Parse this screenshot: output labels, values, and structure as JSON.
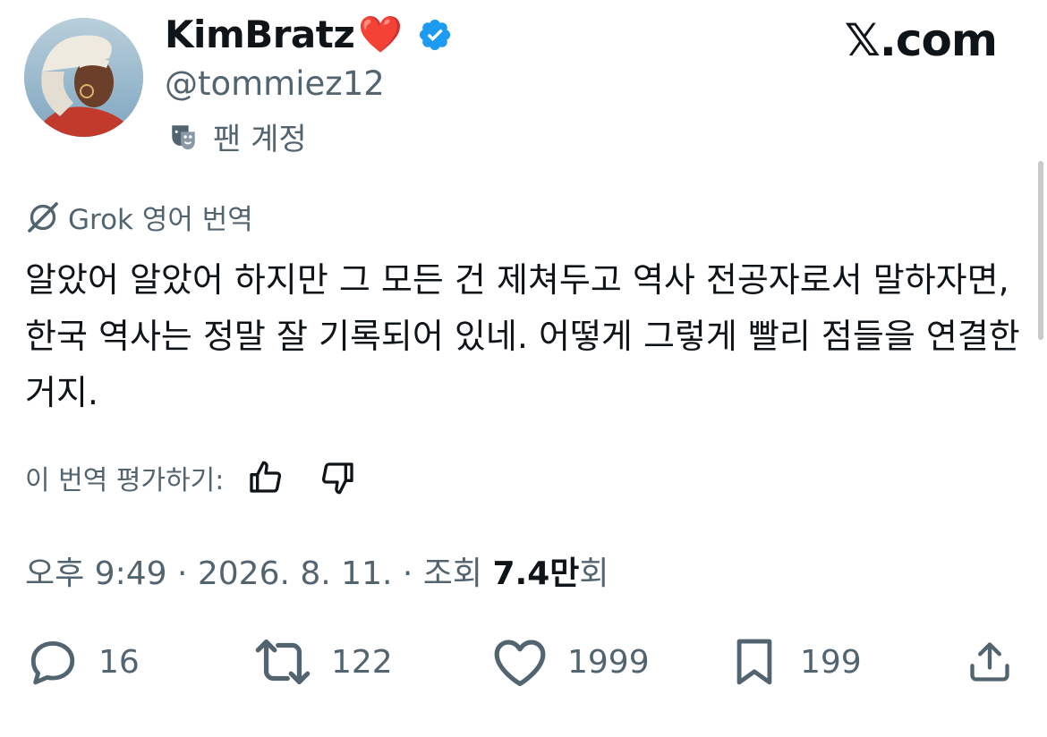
{
  "author": {
    "display_name": "KimBratz",
    "name_emoji": "❤️",
    "handle": "@tommiez12",
    "account_label": "팬 계정",
    "verified": true,
    "verified_color": "#1d9bf0"
  },
  "brand": "𝕏.com",
  "translation": {
    "header": "Grok 영어 번역",
    "text": "알았어 알았어 하지만 그 모든 건 제쳐두고 역사 전공자로서 말하자면, 한국 역사는 정말 잘 기록되어 있네. 어떻게 그렇게 빨리 점들을 연결한 거지.",
    "rate_label": "이 번역 평가하기:"
  },
  "meta": {
    "time": "오후 9:49",
    "date": "2026. 8. 11.",
    "views_label": "조회",
    "views_number": "7.4만",
    "views_suffix": "회"
  },
  "actions": {
    "replies": "16",
    "reposts": "122",
    "likes": "1999",
    "bookmarks": "199"
  },
  "icons": [
    "verified-badge-icon",
    "fan-mask-icon",
    "grok-icon",
    "thumbs-up-icon",
    "thumbs-down-icon",
    "reply-icon",
    "repost-icon",
    "like-icon",
    "bookmark-icon",
    "share-icon"
  ]
}
